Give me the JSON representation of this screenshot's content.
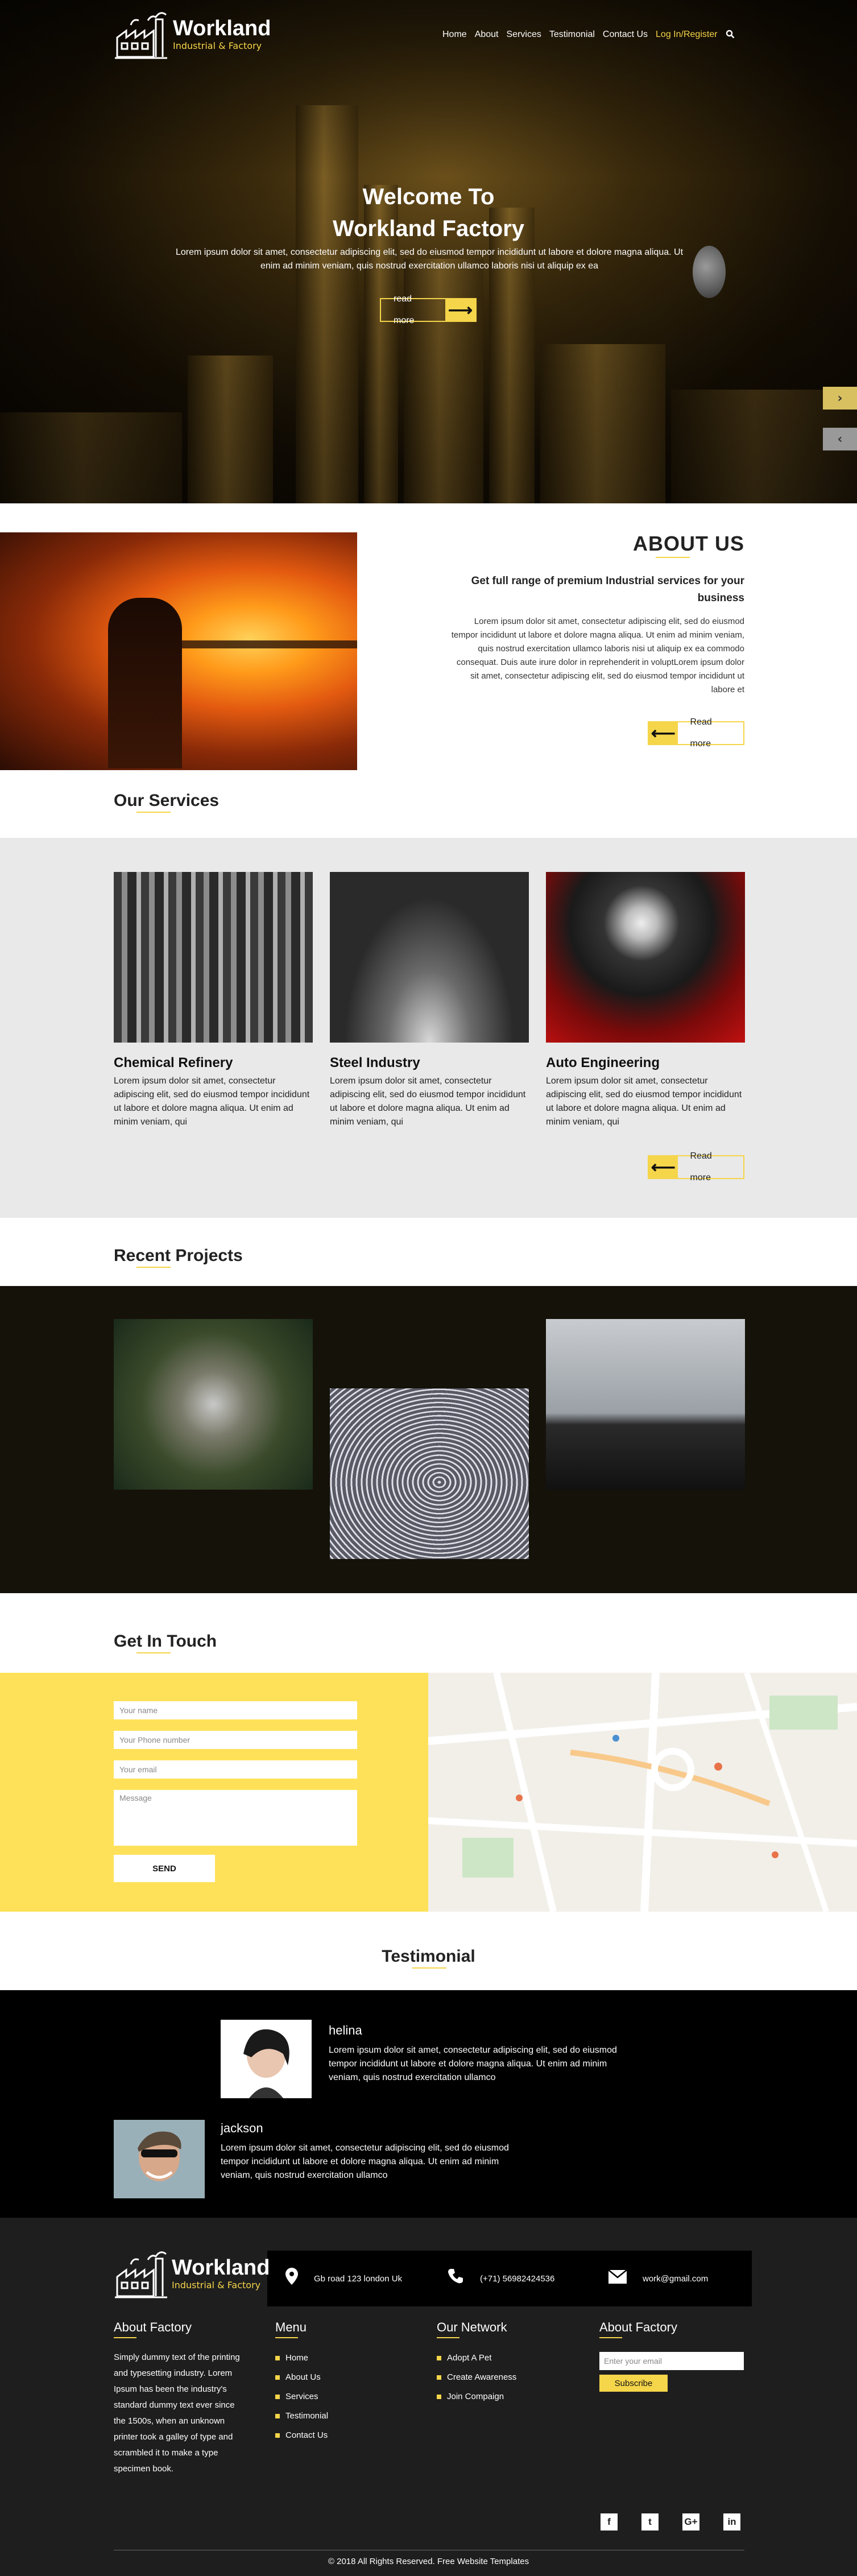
{
  "brand": {
    "title": "Workland",
    "subtitle": "Industrial & Factory"
  },
  "nav": {
    "items": [
      "Home",
      "About",
      "Services",
      "Testimonial",
      "Contact Us"
    ],
    "login": "Log In/Register"
  },
  "hero": {
    "title_line1": "Welcome To",
    "title_line2": "Workland Factory",
    "text": "Lorem ipsum dolor sit amet, consectetur adipiscing elit, sed do eiusmod tempor incididunt ut labore et dolore magna aliqua. Ut enim ad minim veniam, quis nostrud exercitation ullamco laboris nisi ut aliquip ex ea",
    "button": "read more"
  },
  "about": {
    "title": "ABOUT US",
    "subtitle": "Get full range of premium Industrial services for your business",
    "text": "Lorem ipsum dolor sit amet, consectetur adipiscing elit, sed do eiusmod tempor incididunt ut labore et dolore magna aliqua. Ut enim ad minim veniam, quis nostrud exercitation ullamco laboris nisi ut aliquip ex ea commodo consequat. Duis aute irure dolor in reprehenderit in voluptLorem ipsum dolor sit amet, consectetur adipiscing elit, sed do eiusmod tempor incididunt ut labore et",
    "button": "Read more"
  },
  "services": {
    "title": "Our Services",
    "items": [
      {
        "title": "Chemical Refinery",
        "text": "Lorem ipsum dolor sit amet, consectetur adipiscing elit, sed do eiusmod tempor incididunt ut labore et dolore magna aliqua. Ut enim ad minim veniam, qui"
      },
      {
        "title": "Steel Industry",
        "text": "Lorem ipsum dolor sit amet, consectetur adipiscing elit, sed do eiusmod tempor incididunt ut labore et dolore magna aliqua. Ut enim ad minim veniam, qui"
      },
      {
        "title": "Auto Engineering",
        "text": "Lorem ipsum dolor sit amet, consectetur adipiscing elit, sed do eiusmod tempor incididunt ut labore et dolore magna aliqua. Ut enim ad minim veniam, qui"
      }
    ],
    "button": "Read more"
  },
  "projects": {
    "title": "Recent Projects"
  },
  "contact": {
    "title": "Get In Touch",
    "name_placeholder": "Your name",
    "phone_placeholder": "Your Phone number",
    "email_placeholder": "Your email",
    "message_placeholder": "Message",
    "send": "SEND"
  },
  "testimonial": {
    "title": "Testimonial",
    "items": [
      {
        "name": "helina",
        "text": "Lorem ipsum dolor sit amet, consectetur adipiscing elit, sed do eiusmod tempor incididunt ut labore et dolore magna aliqua. Ut enim ad minim veniam, quis nostrud exercitation ullamco"
      },
      {
        "name": "jackson",
        "text": "Lorem ipsum dolor sit amet, consectetur adipiscing elit, sed do eiusmod tempor incididunt ut labore et dolore magna aliqua. Ut enim ad minim veniam, quis nostrud exercitation ullamco"
      }
    ]
  },
  "footer": {
    "address": "Gb road 123 london Uk",
    "phone": "(+71) 56982424536",
    "email": "work@gmail.com",
    "about_title": "About Factory",
    "about_text": "Simply dummy text of the printing and typesetting industry. Lorem Ipsum has been the industry's standard dummy text ever since the 1500s, when an unknown printer took a galley of type and scrambled it to make a type specimen book.",
    "menu_title": "Menu",
    "menu_items": [
      "Home",
      "About Us",
      "Services",
      "Testimonial",
      "Contact Us"
    ],
    "network_title": "Our Network",
    "network_items": [
      "Adopt A Pet",
      "Create Awareness",
      "Join Compaign"
    ],
    "subscribe_title": "About Factory",
    "email_placeholder": "Enter your email",
    "subscribe_button": "Subscribe",
    "socials": [
      "f",
      "t",
      "G+",
      "in"
    ],
    "copyright": "© 2018 All Rights Reserved. Free Website Templates"
  },
  "colors": {
    "accent": "#f5d54a",
    "form_bg": "#fee159",
    "dark": "#15120a"
  },
  "icons": [
    "search-icon",
    "arrow-right-icon",
    "arrow-left-icon",
    "map-pin-icon",
    "phone-icon",
    "mail-icon",
    "facebook-icon",
    "twitter-icon",
    "google-plus-icon",
    "linkedin-icon"
  ]
}
